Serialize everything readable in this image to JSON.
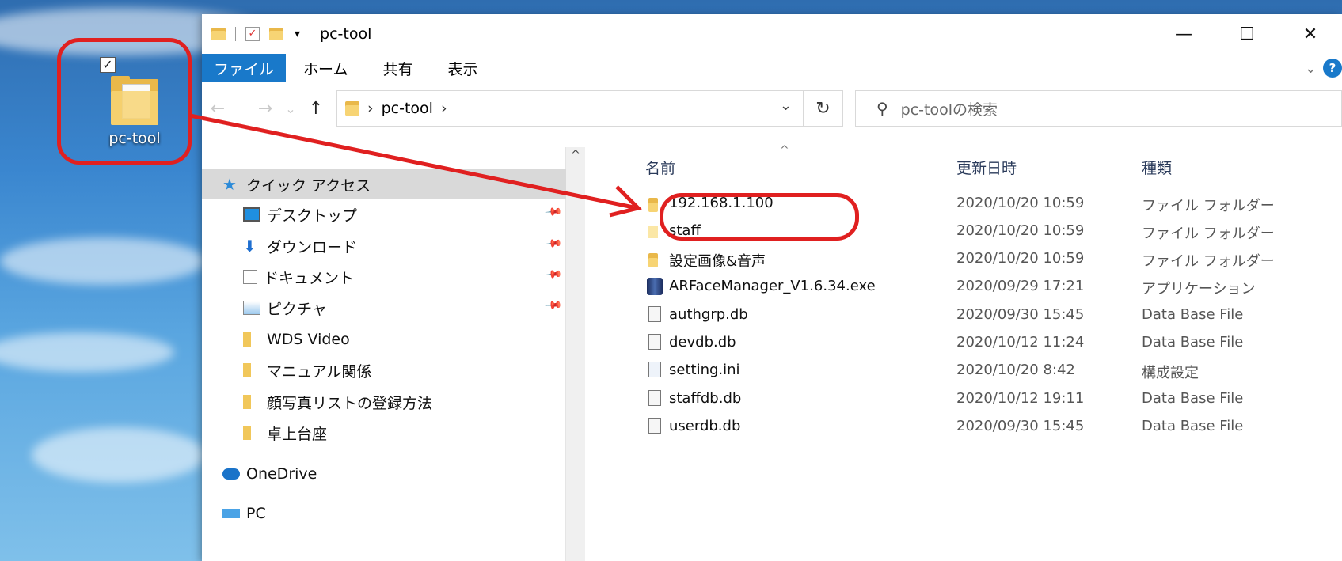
{
  "desktop": {
    "icon_label": "pc-tool",
    "icon_checked": "✓"
  },
  "window": {
    "title": "pc-tool",
    "qa_dropdown": "▾",
    "controls": {
      "minimize": "—",
      "maximize": "☐",
      "close": "✕"
    }
  },
  "ribbon": {
    "tabs": [
      "ファイル",
      "ホーム",
      "共有",
      "表示"
    ],
    "expand": "⌄",
    "help": "?"
  },
  "address_bar": {
    "back": "←",
    "forward": "→",
    "recent": "⌄",
    "up": "↑",
    "crumb_sep_1": "›",
    "crumb": "pc-tool",
    "crumb_sep_2": "›",
    "dropdown": "⌄",
    "refresh": "↻",
    "search_icon": "⚲",
    "search_placeholder": "pc-toolの検索"
  },
  "nav_pane": {
    "scroll_up": "^",
    "items": [
      {
        "label": "クイック アクセス",
        "icon": "star-icon",
        "selected": true
      },
      {
        "label": "デスクトップ",
        "icon": "desktop-icon",
        "pinned": true
      },
      {
        "label": "ダウンロード",
        "icon": "download-arrow-icon",
        "pinned": true
      },
      {
        "label": "ドキュメント",
        "icon": "documents-icon",
        "pinned": true
      },
      {
        "label": "ピクチャ",
        "icon": "pictures-icon",
        "pinned": true
      },
      {
        "label": "WDS Video",
        "icon": "folder-icon"
      },
      {
        "label": "マニュアル関係",
        "icon": "folder-icon"
      },
      {
        "label": "顔写真リストの登録方法",
        "icon": "folder-icon"
      },
      {
        "label": "卓上台座",
        "icon": "folder-icon"
      },
      {
        "label": "OneDrive",
        "icon": "onedrive-cloud-icon"
      },
      {
        "label": "PC",
        "icon": "pc-icon"
      }
    ]
  },
  "file_list": {
    "columns": {
      "name": "名前",
      "date": "更新日時",
      "type": "種類"
    },
    "sort_indicator": "^",
    "rows": [
      {
        "name": "192.168.1.100",
        "date": "2020/10/20 10:59",
        "type": "ファイル フォルダー",
        "icon": "folder-icon"
      },
      {
        "name": "staff",
        "date": "2020/10/20 10:59",
        "type": "ファイル フォルダー",
        "icon": "folder-light-icon"
      },
      {
        "name": "設定画像&音声",
        "date": "2020/10/20 10:59",
        "type": "ファイル フォルダー",
        "icon": "folder-icon"
      },
      {
        "name": "ARFaceManager_V1.6.34.exe",
        "date": "2020/09/29 17:21",
        "type": "アプリケーション",
        "icon": "exe-icon"
      },
      {
        "name": "authgrp.db",
        "date": "2020/09/30 15:45",
        "type": "Data Base File",
        "icon": "db-file-icon"
      },
      {
        "name": "devdb.db",
        "date": "2020/10/12 11:24",
        "type": "Data Base File",
        "icon": "db-file-icon"
      },
      {
        "name": "setting.ini",
        "date": "2020/10/20 8:42",
        "type": "構成設定",
        "icon": "ini-file-icon"
      },
      {
        "name": "staffdb.db",
        "date": "2020/10/12 19:11",
        "type": "Data Base File",
        "icon": "db-file-icon"
      },
      {
        "name": "userdb.db",
        "date": "2020/09/30 15:45",
        "type": "Data Base File",
        "icon": "db-file-icon"
      }
    ]
  },
  "colors": {
    "annotation_red": "#e02020",
    "ribbon_blue": "#1979ca",
    "folder": "#f7d474"
  }
}
